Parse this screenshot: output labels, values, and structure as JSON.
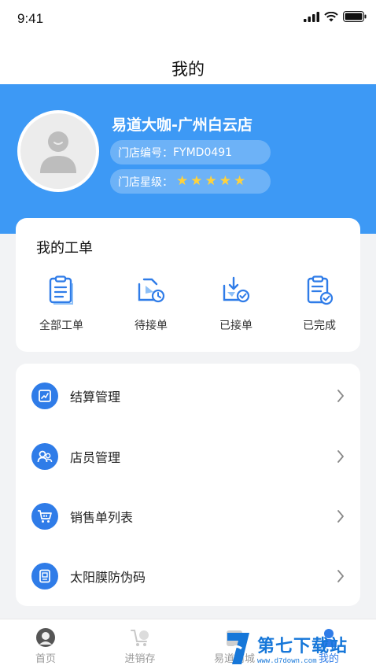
{
  "status_bar": {
    "time": "9:41"
  },
  "nav": {
    "title": "我的"
  },
  "profile": {
    "store_name": "易道大咖-广州白云店",
    "store_code_label": "门店编号：",
    "store_code": "FYMD0491",
    "store_rating_label": "门店星级：",
    "stars": 5
  },
  "orders": {
    "title": "我的工单",
    "items": [
      {
        "label": "全部工单",
        "icon": "clipboard-icon"
      },
      {
        "label": "待接单",
        "icon": "truck-clock-icon"
      },
      {
        "label": "已接单",
        "icon": "download-check-icon"
      },
      {
        "label": "已完成",
        "icon": "clipboard-check-icon"
      }
    ]
  },
  "menu": {
    "items": [
      {
        "label": "结算管理",
        "icon": "settlement-icon"
      },
      {
        "label": "店员管理",
        "icon": "staff-icon"
      },
      {
        "label": "销售单列表",
        "icon": "cart-icon"
      },
      {
        "label": "太阳膜防伪码",
        "icon": "code-card-icon"
      }
    ]
  },
  "tabs": [
    {
      "label": "首页",
      "icon": "home-avatar-icon"
    },
    {
      "label": "进销存",
      "icon": "cart-tab-icon"
    },
    {
      "label": "易道商城",
      "icon": "mall-icon"
    },
    {
      "label": "我的",
      "icon": "profile-icon"
    }
  ],
  "watermark": {
    "text": "第七下载站",
    "url": "www.d7down.com"
  },
  "colors": {
    "accent": "#3d99f5",
    "primary": "#2f7ce8",
    "star": "#ffd23c"
  }
}
